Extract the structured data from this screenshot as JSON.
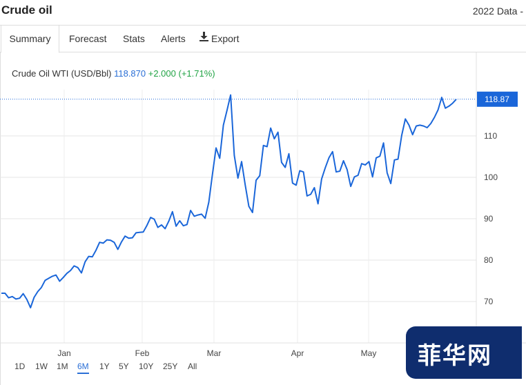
{
  "header": {
    "title": "Crude oil",
    "right_text": "2022 Data -"
  },
  "tabs": [
    {
      "label": "Summary",
      "active": true
    },
    {
      "label": "Forecast"
    },
    {
      "label": "Stats"
    },
    {
      "label": "Alerts"
    },
    {
      "label": "Export",
      "icon": "download-icon"
    }
  ],
  "quote": {
    "name": "Crude Oil WTI (USD/Bbl)",
    "price": "118.870",
    "change": "+2.000 (+1.71%)"
  },
  "ranges": [
    {
      "label": "1D"
    },
    {
      "label": "1W"
    },
    {
      "label": "1M"
    },
    {
      "label": "6M",
      "active": true
    },
    {
      "label": "1Y"
    },
    {
      "label": "5Y"
    },
    {
      "label": "10Y"
    },
    {
      "label": "25Y"
    },
    {
      "label": "All"
    }
  ],
  "watermark": {
    "text": "菲华网"
  },
  "colors": {
    "line": "#1a66d9",
    "accent": "#2a6fd6",
    "positive": "#21a345",
    "label_bg": "#1a66d9",
    "badge": "#0f2d6e"
  },
  "chart_data": {
    "type": "line",
    "x_ticks": [
      "Jan",
      "Feb",
      "Mar",
      "Apr",
      "May"
    ],
    "y_ticks": [
      70,
      80,
      90,
      100,
      110
    ],
    "ylim": [
      60,
      120
    ],
    "last_label": "118.87",
    "series": [
      {
        "values": [
          72.0,
          72.0,
          70.9,
          71.2,
          70.6,
          70.8,
          71.9,
          70.5,
          68.5,
          71.0,
          72.4,
          73.4,
          75.1,
          75.6,
          76.1,
          76.4,
          74.9,
          75.8,
          76.8,
          77.5,
          78.6,
          78.2,
          76.9,
          79.6,
          80.9,
          80.8,
          82.4,
          84.3,
          84.1,
          84.9,
          84.8,
          84.3,
          82.6,
          84.4,
          85.8,
          85.3,
          85.4,
          86.6,
          86.7,
          86.8,
          88.4,
          90.3,
          89.9,
          87.9,
          88.5,
          87.6,
          89.4,
          91.7,
          88.2,
          89.5,
          88.3,
          88.6,
          92.0,
          90.6,
          90.9,
          91.1,
          90.1,
          94.0,
          100.8,
          107.1,
          104.6,
          112.6,
          116.2,
          119.9,
          105.3,
          99.8,
          103.8,
          98.2,
          93.0,
          91.5,
          99.3,
          100.4,
          107.7,
          107.4,
          111.9,
          109.3,
          110.9,
          103.6,
          102.4,
          105.7,
          98.6,
          98.1,
          101.6,
          101.3,
          95.5,
          95.9,
          97.5,
          93.6,
          99.6,
          102.3,
          104.7,
          106.2,
          101.3,
          101.5,
          104.0,
          101.9,
          97.8,
          100.1,
          100.5,
          103.3,
          103.0,
          103.8,
          100.1,
          104.7,
          105.1,
          108.3,
          101.1,
          98.5,
          104.2,
          104.4,
          110.1,
          114.1,
          112.6,
          110.3,
          112.4,
          112.6,
          112.4,
          112.0,
          113.0,
          114.5,
          116.3,
          119.3,
          116.7,
          117.2,
          117.9,
          118.87
        ]
      }
    ]
  }
}
